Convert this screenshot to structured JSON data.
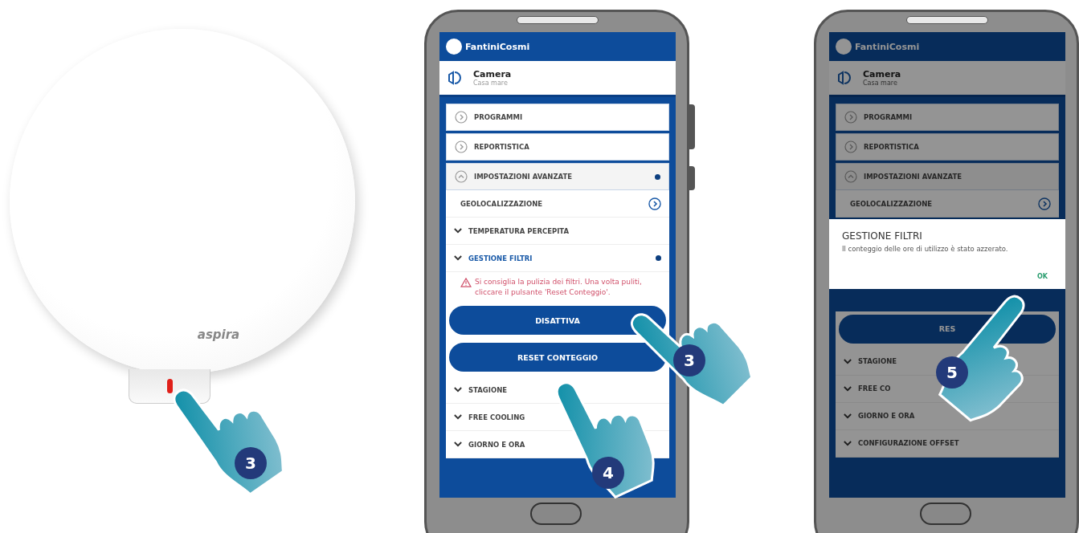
{
  "device": {
    "brand": "aspira",
    "led_on": true,
    "step": "3"
  },
  "phones": [
    {
      "logo": "FantiniCosmi",
      "room": "Camera",
      "room_subtitle": "Casa mare",
      "dimmed": false,
      "steps": [
        "3",
        "4"
      ],
      "items": [
        {
          "kind": "card",
          "label": "PROGRAMMI",
          "expanded": false,
          "dot": false
        },
        {
          "kind": "card",
          "label": "REPORTISTICA",
          "expanded": false,
          "dot": false
        },
        {
          "kind": "card",
          "label": "IMPOSTAZIONI AVANZATE",
          "expanded": true,
          "dot": true
        },
        {
          "kind": "link",
          "label": "GEOLOCALIZZAZIONE"
        },
        {
          "kind": "section",
          "label": "TEMPERATURA PERCEPITA",
          "highlighted": false,
          "dot": false
        },
        {
          "kind": "section",
          "label": "GESTIONE FILTRI",
          "highlighted": true,
          "dot": true
        },
        {
          "kind": "warning",
          "text": "Si consiglia la pulizia dei filtri. Una volta puliti, cliccare il pulsante 'Reset Conteggio'."
        },
        {
          "kind": "button",
          "label": "DISATTIVA"
        },
        {
          "kind": "button",
          "label": "RESET CONTEGGIO"
        },
        {
          "kind": "section",
          "label": "STAGIONE",
          "highlighted": false,
          "dot": false
        },
        {
          "kind": "section",
          "label": "FREE COOLING",
          "highlighted": false,
          "dot": false
        },
        {
          "kind": "section",
          "label": "GIORNO E ORA",
          "highlighted": false,
          "dot": false
        }
      ]
    },
    {
      "logo": "FantiniCosmi",
      "room": "Camera",
      "room_subtitle": "Casa mare",
      "dimmed": true,
      "steps": [
        "5"
      ],
      "items": [
        {
          "kind": "card",
          "label": "PROGRAMMI",
          "expanded": false,
          "dot": false
        },
        {
          "kind": "card",
          "label": "REPORTISTICA",
          "expanded": false,
          "dot": false
        },
        {
          "kind": "card",
          "label": "IMPOSTAZIONI AVANZATE",
          "expanded": true,
          "dot": false
        },
        {
          "kind": "link",
          "label": "GEOLOCALIZZAZIONE"
        },
        {
          "kind": "dialog",
          "title": "GESTIONE FILTRI",
          "text": "Il conteggio delle ore di utilizzo è stato azzerato.",
          "button": "OK"
        },
        {
          "kind": "button",
          "label": "RES"
        },
        {
          "kind": "section",
          "label": "STAGIONE",
          "highlighted": false,
          "dot": false
        },
        {
          "kind": "section",
          "label": "FREE CO",
          "highlighted": false,
          "dot": false
        },
        {
          "kind": "section",
          "label": "GIORNO E ORA",
          "highlighted": false,
          "dot": false
        },
        {
          "kind": "section",
          "label": "CONFIGURAZIONE OFFSET",
          "highlighted": false,
          "dot": false
        }
      ]
    }
  ]
}
